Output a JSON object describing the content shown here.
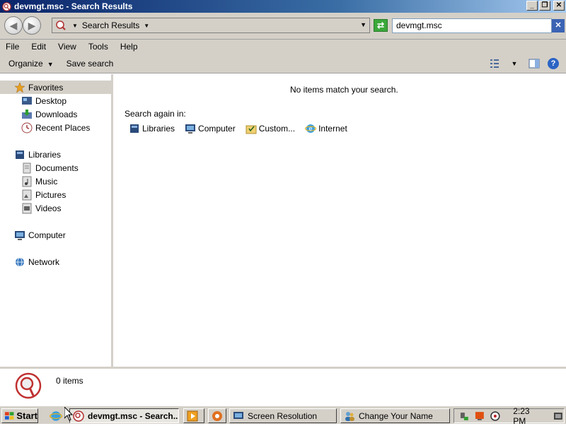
{
  "window": {
    "title": "devmgt.msc - Search Results",
    "controls": [
      "minimize",
      "restore",
      "close"
    ]
  },
  "address_bar": {
    "breadcrumb": "Search Results",
    "search_value": "devmgt.msc"
  },
  "menu": [
    "File",
    "Edit",
    "View",
    "Tools",
    "Help"
  ],
  "command_bar": {
    "organize": "Organize",
    "save_search": "Save search"
  },
  "sidebar": {
    "favorites": {
      "label": "Favorites",
      "items": [
        "Desktop",
        "Downloads",
        "Recent Places"
      ]
    },
    "libraries": {
      "label": "Libraries",
      "items": [
        "Documents",
        "Music",
        "Pictures",
        "Videos"
      ]
    },
    "computer": "Computer",
    "network": "Network"
  },
  "content": {
    "message": "No items match your search.",
    "search_again_label": "Search again in:",
    "scopes": [
      "Libraries",
      "Computer",
      "Custom...",
      "Internet"
    ]
  },
  "details": {
    "count": "0 items"
  },
  "taskbar": {
    "start": "Start",
    "tasks": [
      "devmgt.msc - Search...",
      "Screen Resolution",
      "Change Your Name"
    ],
    "clock": "2:23 PM"
  },
  "colors": {
    "title_gradient_start": "#0a246a",
    "title_gradient_end": "#a6caf0",
    "chrome": "#d4d0c8"
  }
}
